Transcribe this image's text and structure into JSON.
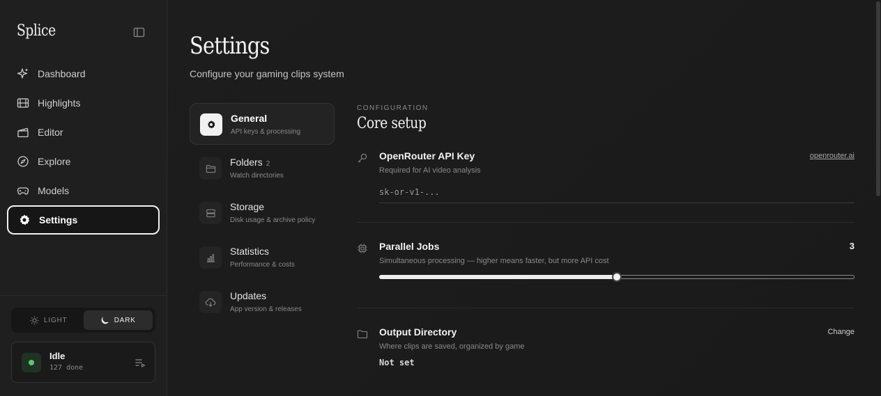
{
  "brand": "Splice",
  "sidebar": {
    "items": [
      {
        "label": "Dashboard",
        "icon": "sparkle-icon"
      },
      {
        "label": "Highlights",
        "icon": "film-icon"
      },
      {
        "label": "Editor",
        "icon": "clapperboard-icon"
      },
      {
        "label": "Explore",
        "icon": "compass-icon"
      },
      {
        "label": "Models",
        "icon": "gamepad-icon"
      },
      {
        "label": "Settings",
        "icon": "gear-icon",
        "active": true
      }
    ],
    "theme": {
      "light": "LIGHT",
      "dark": "DARK",
      "selected": "dark"
    },
    "status": {
      "title": "Idle",
      "subtitle": "127 done",
      "color": "#62c46f"
    }
  },
  "page": {
    "title": "Settings",
    "subtitle": "Configure your gaming clips system"
  },
  "sections": [
    {
      "label": "General",
      "count": "",
      "desc": "API keys & processing",
      "icon": "gear-icon",
      "active": true
    },
    {
      "label": "Folders",
      "count": "2",
      "desc": "Watch directories",
      "icon": "folder-icon"
    },
    {
      "label": "Storage",
      "count": "",
      "desc": "Disk usage & archive policy",
      "icon": "storage-icon"
    },
    {
      "label": "Statistics",
      "count": "",
      "desc": "Performance & costs",
      "icon": "bar-chart-icon"
    },
    {
      "label": "Updates",
      "count": "",
      "desc": "App version & releases",
      "icon": "cloud-download-icon"
    }
  ],
  "panel": {
    "eyebrow": "CONFIGURATION",
    "title": "Core setup",
    "api_key": {
      "title": "OpenRouter API Key",
      "desc": "Required for AI video analysis",
      "link": "openrouter.ai",
      "placeholder": "sk-or-v1-..."
    },
    "parallel_jobs": {
      "title": "Parallel Jobs",
      "desc": "Simultaneous processing — higher means faster, but more API cost",
      "value": "3",
      "fraction": 0.5
    },
    "output_dir": {
      "title": "Output Directory",
      "desc": "Where clips are saved, organized by game",
      "action": "Change",
      "value": "Not set"
    }
  }
}
